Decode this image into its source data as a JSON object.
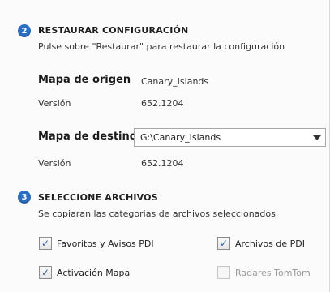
{
  "restore": {
    "step": "2",
    "title": "RESTAURAR CONFIGURACIÓN",
    "subtitle": "Pulse sobre \"Restaurar\" para restaurar la configuración",
    "source_map_label": "Mapa de origen",
    "source_map_value": "Canary_Islands",
    "source_version_label": "Versión",
    "source_version_value": "652.1204",
    "dest_map_label": "Mapa de destino",
    "dest_map_value": "G:\\Canary_Islands",
    "dest_version_label": "Versión",
    "dest_version_value": "652.1204"
  },
  "files": {
    "step": "3",
    "title": "SELECCIONE ARCHIVOS",
    "subtitle": "Se copiaran las categorias de archivos seleccionados",
    "options": [
      {
        "label": "Favoritos y Avisos PDI",
        "checked": true,
        "enabled": true
      },
      {
        "label": "Archivos de PDI",
        "checked": true,
        "enabled": true
      },
      {
        "label": "Activación Mapa",
        "checked": true,
        "enabled": true
      },
      {
        "label": "Radares TomTom",
        "checked": false,
        "enabled": false
      }
    ]
  },
  "colors": {
    "accent": "#2a6fc4",
    "check": "#2d62b3"
  }
}
